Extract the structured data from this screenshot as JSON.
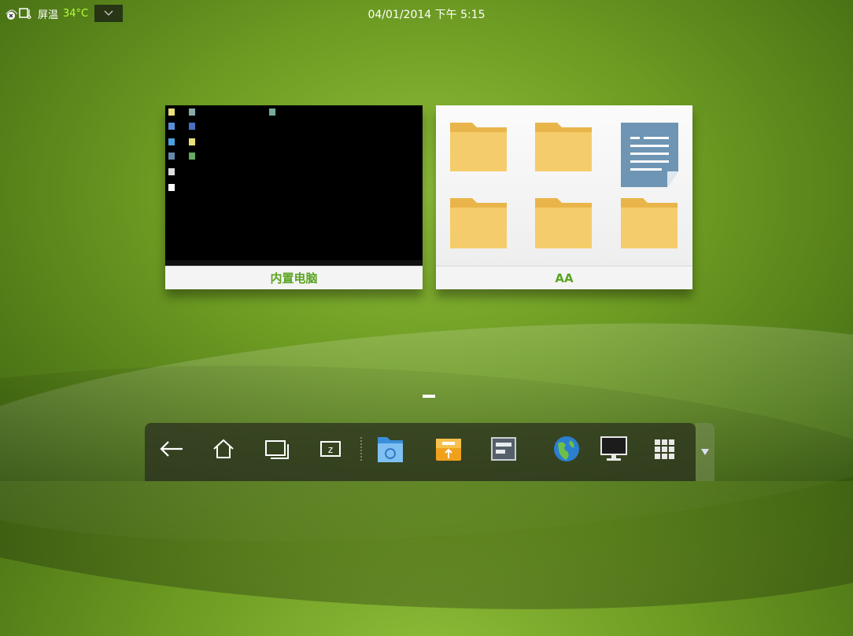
{
  "status_bar": {
    "temp_label": "屏温",
    "temp_value": "34°C",
    "datetime": "04/01/2014 下午 5:15",
    "icons": [
      "close-circle-icon",
      "screen-temp-icon",
      "chevron-down-icon"
    ]
  },
  "cards": [
    {
      "label": "内置电脑",
      "thumbnail": "windows-desktop"
    },
    {
      "label": "AA",
      "thumbnail": "folder-grid"
    }
  ],
  "dock": {
    "items": [
      "back-icon",
      "home-icon",
      "recent-apps-icon",
      "zoom-icon",
      "file-manager-icon",
      "usb-icon",
      "settings-panel-icon",
      "browser-globe-icon",
      "monitor-icon",
      "apps-grid-icon"
    ],
    "handle_icon": "triangle-down-icon"
  },
  "colors": {
    "accent_green": "#5aa422",
    "temp_green": "#b7ff3a",
    "folder_yellow": "#f2c45a",
    "doc_blue": "#6e96b4"
  }
}
